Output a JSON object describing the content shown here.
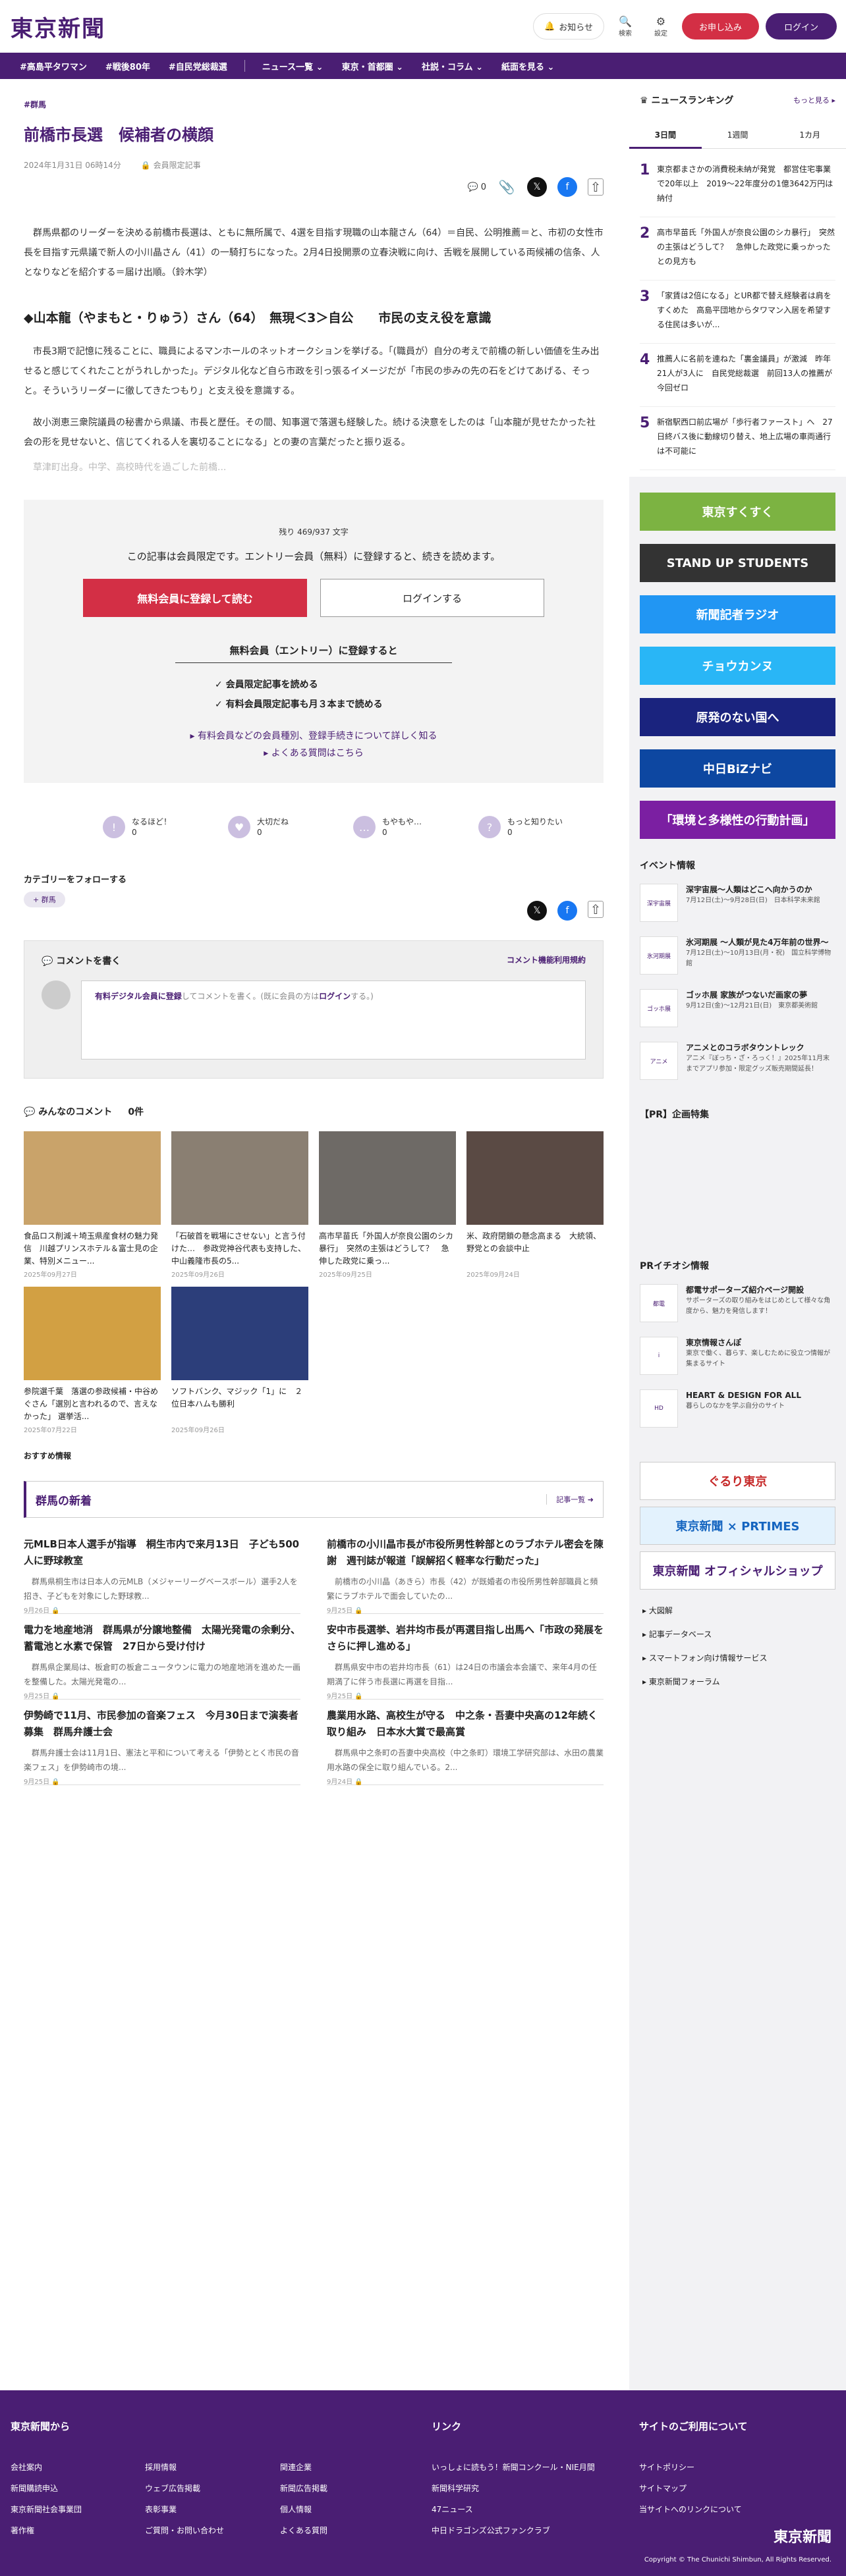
{
  "header": {
    "logo": "東京新聞",
    "notice": "お知らせ",
    "search": "検索",
    "settings": "設定",
    "signup": "お申し込み",
    "login": "ログイン"
  },
  "nav": {
    "tags": [
      "#高島平タワマン",
      "#戦後80年",
      "#自民党総裁選"
    ],
    "menus": [
      "ニュース一覧 ⌄",
      "東京・首都圏 ⌄",
      "社説・コラム ⌄",
      "紙面を見る ⌄"
    ]
  },
  "article": {
    "category": "#群馬",
    "title": "前橋市長選　候補者の横顔",
    "date": "2024年1月31日 06時14分",
    "members_only": "会員限定記事",
    "comment_count": "0",
    "lead": "群馬県都のリーダーを決める前橋市長選は、ともに無所属で、4選を目指す現職の山本龍さん（64）＝自民、公明推薦＝と、市初の女性市長を目指す元県議で新人の小川晶さん（41）の一騎打ちになった。2月4日投開票の立春決戦に向け、舌戦を展開している両候補の信条、人となりなどを紹介する＝届け出順。（鈴木学）",
    "subhead": "◆山本龍（やまもと・りゅう）さん（64）　無現＜3＞自公　　市民の支え役を意識",
    "p1": "市長3期で記憶に残ることに、職員によるマンホールのネットオークションを挙げる。「(職員が）自分の考えで前橋の新しい価値を生み出せると感じてくれたことがうれしかった」。デジタル化など自ら市政を引っ張るイメージだが「市民の歩みの先の石をどけてあげる、そっと。そういうリーダーに徹してきたつもり」と支え役を意識する。",
    "p2": "故小渕恵三衆院議員の秘書から県議、市長と歴任。その間、知事選で落選も経験した。続ける決意をしたのは「山本龍が見せたかった社会の形を見せないと、信じてくれる人を裏切ることになる」との妻の言葉だったと振り返る。",
    "p3": "草津町出身。中学、高校時代を過ごした前橋..."
  },
  "paywall": {
    "remain": "残り 469/937 文字",
    "message": "この記事は会員限定です。エントリー会員（無料）に登録すると、続きを読めます。",
    "register_btn": "無料会員に登録して読む",
    "login_btn": "ログインする",
    "entry_heading": "無料会員（エントリー）に登録すると",
    "benefit1": "✓ 会員限定記事を読める",
    "benefit2": "✓ 有料会員限定記事も月３本まで読める",
    "link1": "▸ 有料会員などの会員種別、登録手続きについて詳しく知る",
    "link2": "▸ よくある質問はこちら"
  },
  "reactions": [
    {
      "label": "なるほど！",
      "count": "0",
      "icon": "!"
    },
    {
      "label": "大切だね",
      "count": "0",
      "icon": "♥"
    },
    {
      "label": "もやもや…",
      "count": "0",
      "icon": "…"
    },
    {
      "label": "もっと知りたい",
      "count": "0",
      "icon": "?"
    }
  ],
  "follow": {
    "heading": "カテゴリーをフォローする",
    "tag": "+ 群馬"
  },
  "comment_box": {
    "heading": "コメントを書く",
    "rules": "コメント機能利用規約",
    "prompt_pre": "有料デジタル会員に登録",
    "prompt_mid": "してコメントを書く。(既に会員の方は",
    "prompt_login": "ログイン",
    "prompt_post": "する。)"
  },
  "everyone": {
    "heading": "みんなのコメント",
    "count": "0件"
  },
  "cards": [
    {
      "title": "食品ロス削減＋埼玉県産食材の魅力発信　川越プリンスホテル＆富士見の企業、特別メニュー...",
      "date": "2025年09月27日",
      "color": "#c9a36a"
    },
    {
      "title": "「石破首を戦場にさせない」と言う付けた…　参政党神谷代表も支持した、中山義隆市長の5...",
      "date": "2025年09月26日",
      "color": "#8a7f72"
    },
    {
      "title": "高市早苗氏「外国人が奈良公園のシカ暴行」　突然の主張はどうして？　急伸した政党に乗っ...",
      "date": "2025年09月25日",
      "color": "#6e6a66"
    },
    {
      "title": "米、政府閉鎖の懸念高まる　大統領、野党との会談中止",
      "date": "2025年09月24日",
      "color": "#5a4a44"
    },
    {
      "title": "参院選千葉　落選の参政候補・中谷めぐさん「選別と言われるので、言えなかった」 選挙活...",
      "date": "2025年07月22日",
      "color": "#d2a043"
    },
    {
      "title": "ソフトバンク、マジック「1」に　２位日本ハムも勝利",
      "date": "2025年09月26日",
      "color": "#2c3e7a"
    }
  ],
  "recommended": "おすすめ情報",
  "news": {
    "heading": "群馬の新着",
    "more": "記事一覧 ➜",
    "items": [
      {
        "title": "元MLB日本人選手が指導　桐生市内で来月13日　子ども500人に野球教室",
        "summary": "群馬県桐生市は日本人の元MLB（メジャーリーグベースボール）選手2人を招き、子どもを対象にした野球教...",
        "date": "9月26日"
      },
      {
        "title": "前橋市の小川晶市長が市役所男性幹部とのラブホテル密会を陳謝　週刊誌が報道「誤解招く軽率な行動だった」",
        "summary": "前橋市の小川晶（あきら）市長（42）が既婚者の市役所男性幹部職員と頻繁にラブホテルで面会していたの...",
        "date": "9月25日"
      },
      {
        "title": "電力を地産地消　群馬県が分譲地整備　太陽光発電の余剰分、蓄電池と水素で保管　27日から受け付け",
        "summary": "群馬県企業局は、板倉町の板倉ニュータウンに電力の地産地消を進めた一画を整備した。太陽光発電の...",
        "date": "9月25日"
      },
      {
        "title": "安中市長選挙、岩井均市長が再選目指し出馬へ「市政の発展をさらに押し進める」",
        "summary": "群馬県安中市の岩井均市長（61）は24日の市議会本会議で、来年4月の任期満了に伴う市長選に再選を目指...",
        "date": "9月25日"
      },
      {
        "title": "伊勢崎で11月、市民参加の音楽フェス　今月30日まで演奏者募集　群馬弁護士会",
        "summary": "群馬弁護士会は11月1日、憲法と平和について考える「伊勢ととく市民の音楽フェス」を伊勢崎市の境...",
        "date": "9月25日"
      },
      {
        "title": "農業用水路、高校生が守る　中之条・吾妻中央高の12年続く取り組み　日本水大賞で最高賞",
        "summary": "群馬県中之条町の吾妻中央高校（中之条町）環境工学研究部は、水田の農業用水路の保全に取り組んでいる。2...",
        "date": "9月24日"
      }
    ]
  },
  "sidebar": {
    "ranking_heading": "ニュースランキング",
    "ranking_more": "もっと見る ▸",
    "tabs": [
      "3日間",
      "1週間",
      "1カ月"
    ],
    "ranks": [
      {
        "n": "1",
        "title": "東京都まさかの消費税未納が発覚　都営住宅事業で20年以上　2019〜22年度分の1億3642万円は納付"
      },
      {
        "n": "2",
        "title": "高市早苗氏「外国人が奈良公園のシカ暴行」　突然の主張はどうして？　急伸した政党に乗っかったとの見方も"
      },
      {
        "n": "3",
        "title": "「家賃は2倍になる」とUR都で替え経験者は肩をすくめた　高島平団地からタワマン入居を希望する住民は多いが..."
      },
      {
        "n": "4",
        "title": "推薦人に名前を連ねた「裏金議員」が激減　昨年21人が3人に　自民党総裁選　前回13人の推薦が今回ゼロ"
      },
      {
        "n": "5",
        "title": "新宿駅西口前広場が「歩行者ファースト」へ　27日終バス後に動線切り替え、地上広場の車両通行は不可能に"
      }
    ],
    "banners": [
      {
        "label": "東京すくすく",
        "color": "#7cb342"
      },
      {
        "label": "STAND UP STUDENTS",
        "color": "#333"
      },
      {
        "label": "新聞記者ラジオ",
        "color": "#2196f3"
      },
      {
        "label": "チョウカンヌ",
        "color": "#29b6f6"
      },
      {
        "label": "原発のない国へ",
        "color": "#1a237e"
      },
      {
        "label": "中日BiZナビ",
        "color": "#0d47a1"
      },
      {
        "label": "「環境と多様性の行動計画」",
        "color": "#7b1fa2"
      }
    ],
    "events_heading": "イベント情報",
    "events": [
      {
        "thumb": "深宇宙展",
        "title": "深宇宙展〜人類はどこへ向かうのか",
        "sub": "7月12日(土)〜9月28日(日)　日本科学未来館"
      },
      {
        "thumb": "氷河期展",
        "title": "氷河期展 〜人類が見た4万年前の世界〜",
        "sub": "7月12日(土)〜10月13日(月・祝)　国立科学博物館"
      },
      {
        "thumb": "ゴッホ展",
        "title": "ゴッホ展 家族がつないだ画家の夢",
        "sub": "9月12日(金)〜12月21日(日)　東京都美術館"
      },
      {
        "thumb": "アニメ",
        "title": "アニメとのコラボタウントレック",
        "sub": "アニメ『ぼっち・ざ・ろっく！』2025年11月末までアプリ参加・限定グッズ販売期間延長！"
      }
    ],
    "pr_heading": "【PR】企画特集",
    "prtimes_heading": "PRイチオシ情報",
    "pr": [
      {
        "thumb": "都電",
        "title": "都電サポーターズ紹介ページ開設",
        "sub": "サポーターズの取り組みをはじめとして様々な角度から、魅力を発信します！"
      },
      {
        "thumb": "i",
        "title": "東京情報さんぽ",
        "sub": "東京で働く、暮らす、楽しむために役立つ情報が集まるサイト"
      },
      {
        "thumb": "HD",
        "title": "HEART & DESIGN FOR ALL",
        "sub": "暮らしのなかを学ぶ自分のサイト"
      }
    ],
    "big_banners": [
      {
        "label": "ぐるり東京",
        "color": "#fff",
        "text": "#c62828"
      },
      {
        "label": "東京新聞 × PRTIMES",
        "color": "#e3f2fd",
        "text": "#1565c0"
      },
      {
        "label": "東京新聞 オフィシャルショップ",
        "color": "#fff",
        "text": "#4a1e73"
      }
    ],
    "links": [
      "▸ 大図解",
      "▸ 記事データベース",
      "▸ スマートフォン向け情報サービス",
      "▸ 東京新聞フォーラム"
    ]
  },
  "footer": {
    "col1_heading": "東京新聞から",
    "col1": [
      "会社案内",
      "新聞購読申込",
      "東京新聞社会事業団",
      "著作権",
      "採用情報",
      "ウェブ広告掲載",
      "表彰事業",
      "ご質問・お問い合わせ",
      "関連企業",
      "新聞広告掲載",
      "個人情報",
      "よくある質問"
    ],
    "col2_heading": "リンク",
    "col2": [
      "いっしょに読もう！新聞コンクール・NIE月間",
      "新聞科学研究",
      "47ニュース",
      "中日ドラゴンズ公式ファンクラブ"
    ],
    "col3_heading": "サイトのご利用について",
    "col3": [
      "サイトポリシー",
      "サイトマップ",
      "当サイトへのリンクについて"
    ],
    "logo": "東京新聞",
    "copyright": "Copyright © The Chunichi Shimbun, All Rights Reserved."
  }
}
